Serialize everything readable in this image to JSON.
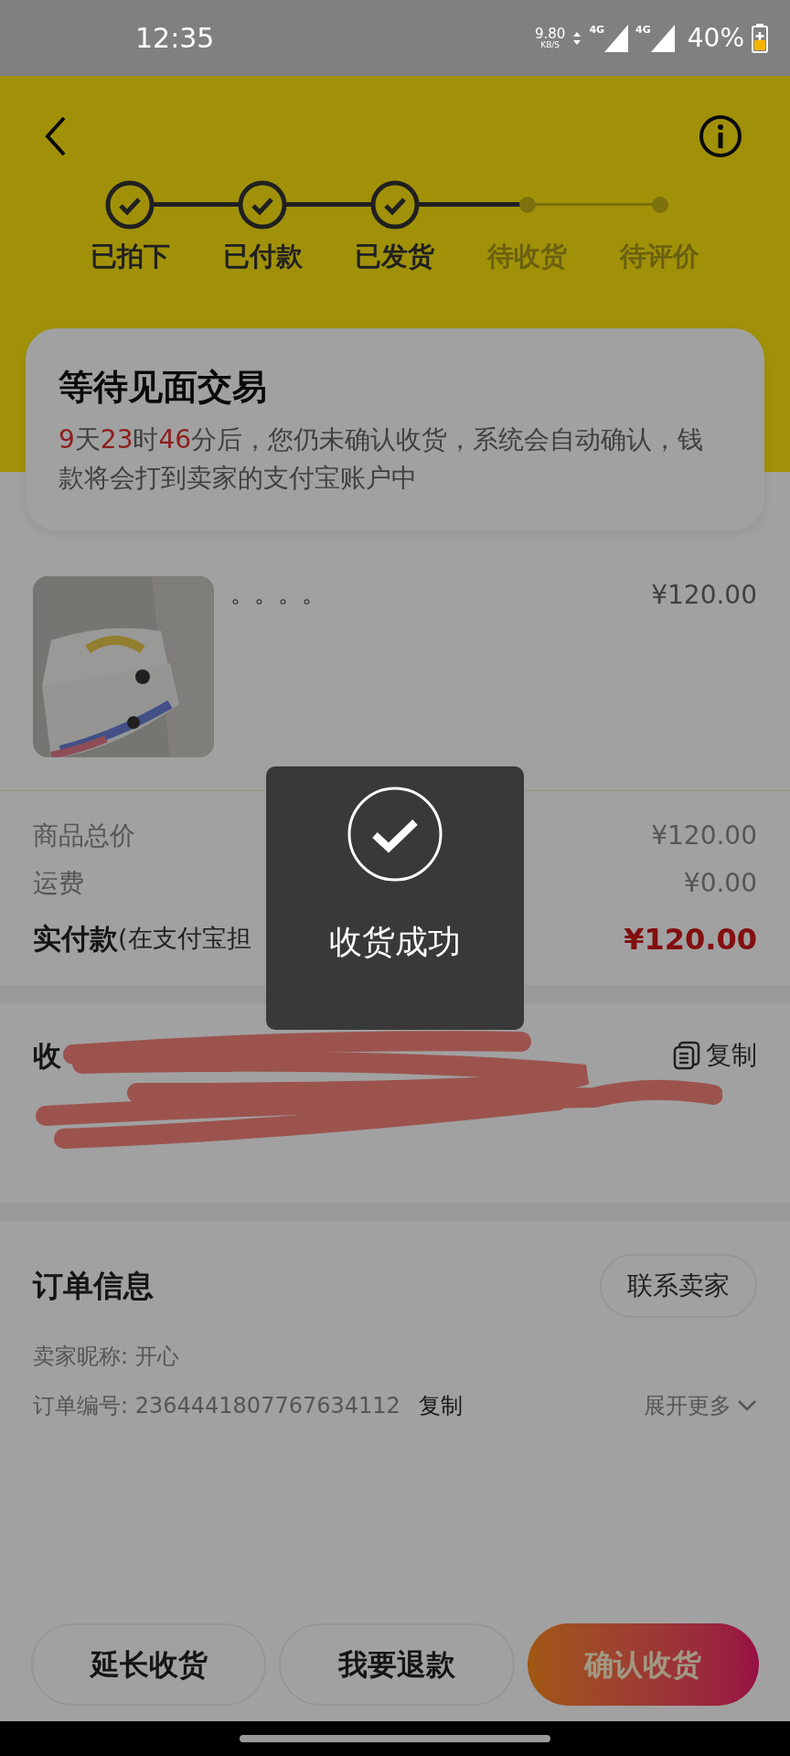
{
  "status_bar": {
    "time": "12:35",
    "net_speed": "9.80",
    "net_unit": "KB/S",
    "signal_labels": [
      "4G",
      "4G"
    ],
    "battery": "40%"
  },
  "steps": [
    {
      "label": "已拍下",
      "done": true
    },
    {
      "label": "已付款",
      "done": true
    },
    {
      "label": "已发货",
      "done": true
    },
    {
      "label": "待收货",
      "done": false
    },
    {
      "label": "待评价",
      "done": false
    }
  ],
  "status_card": {
    "title": "等待见面交易",
    "countdown": [
      {
        "value": "9",
        "unit": "天"
      },
      {
        "value": "23",
        "unit": "时"
      },
      {
        "value": "46",
        "unit": "分"
      }
    ],
    "message": "后，您仍未确认收货，系统会自动确认，钱款将会打到卖家的支付宝账户中"
  },
  "product": {
    "title": "。。。。",
    "price": "¥120.00"
  },
  "costs": [
    {
      "label": "商品总价",
      "value": "¥120.00",
      "kind": "plain"
    },
    {
      "label": "运费",
      "value": "¥0.00",
      "kind": "plain"
    },
    {
      "label": "实付款",
      "note": "(在支付宝担",
      "value": "¥120.00",
      "kind": "total"
    }
  ],
  "address": {
    "heading_visible": "收",
    "copy": "复制"
  },
  "order_info": {
    "title": "订单信息",
    "contact_button": "联系卖家",
    "seller": "卖家昵称: 开心",
    "order_number_label": "订单编号: 2364441807767634112",
    "copy": "复制",
    "expand": "展开更多"
  },
  "actions": [
    {
      "label": "延长收货",
      "kind": "outline"
    },
    {
      "label": "我要退款",
      "kind": "outline"
    },
    {
      "label": "确认收货",
      "kind": "primary"
    }
  ],
  "toast": {
    "text": "收货成功"
  }
}
